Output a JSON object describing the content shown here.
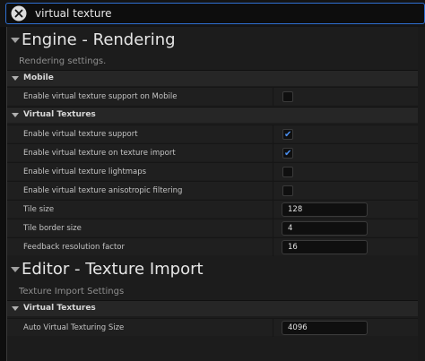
{
  "search": {
    "value": "virtual texture"
  },
  "sections": {
    "engine": {
      "title": "Engine - Rendering",
      "subtitle": "Rendering settings.",
      "mobile": {
        "label": "Mobile",
        "rows": [
          {
            "label": "Enable virtual texture support on Mobile",
            "checked": false
          }
        ]
      },
      "vt": {
        "label": "Virtual Textures",
        "rows": [
          {
            "label": "Enable virtual texture support",
            "checked": true
          },
          {
            "label": "Enable virtual texture on texture import",
            "checked": true
          },
          {
            "label": "Enable virtual texture lightmaps",
            "checked": false
          },
          {
            "label": "Enable virtual texture anisotropic filtering",
            "checked": false
          },
          {
            "label": "Tile size",
            "value": "128"
          },
          {
            "label": "Tile border size",
            "value": "4"
          },
          {
            "label": "Feedback resolution factor",
            "value": "16"
          }
        ]
      }
    },
    "editor": {
      "title": "Editor - Texture Import",
      "subtitle": "Texture Import Settings",
      "vt": {
        "label": "Virtual Textures",
        "rows": [
          {
            "label": "Auto Virtual Texturing Size",
            "value": "4096"
          }
        ]
      }
    }
  },
  "colors": {
    "accent": "#2f6fd1",
    "check": "#4a8ff0",
    "background": "#1c1c1c"
  },
  "icons": {
    "clear": "close-icon",
    "section": "chevron-down-icon",
    "category": "triangle-down-icon",
    "checked": "check-icon"
  }
}
